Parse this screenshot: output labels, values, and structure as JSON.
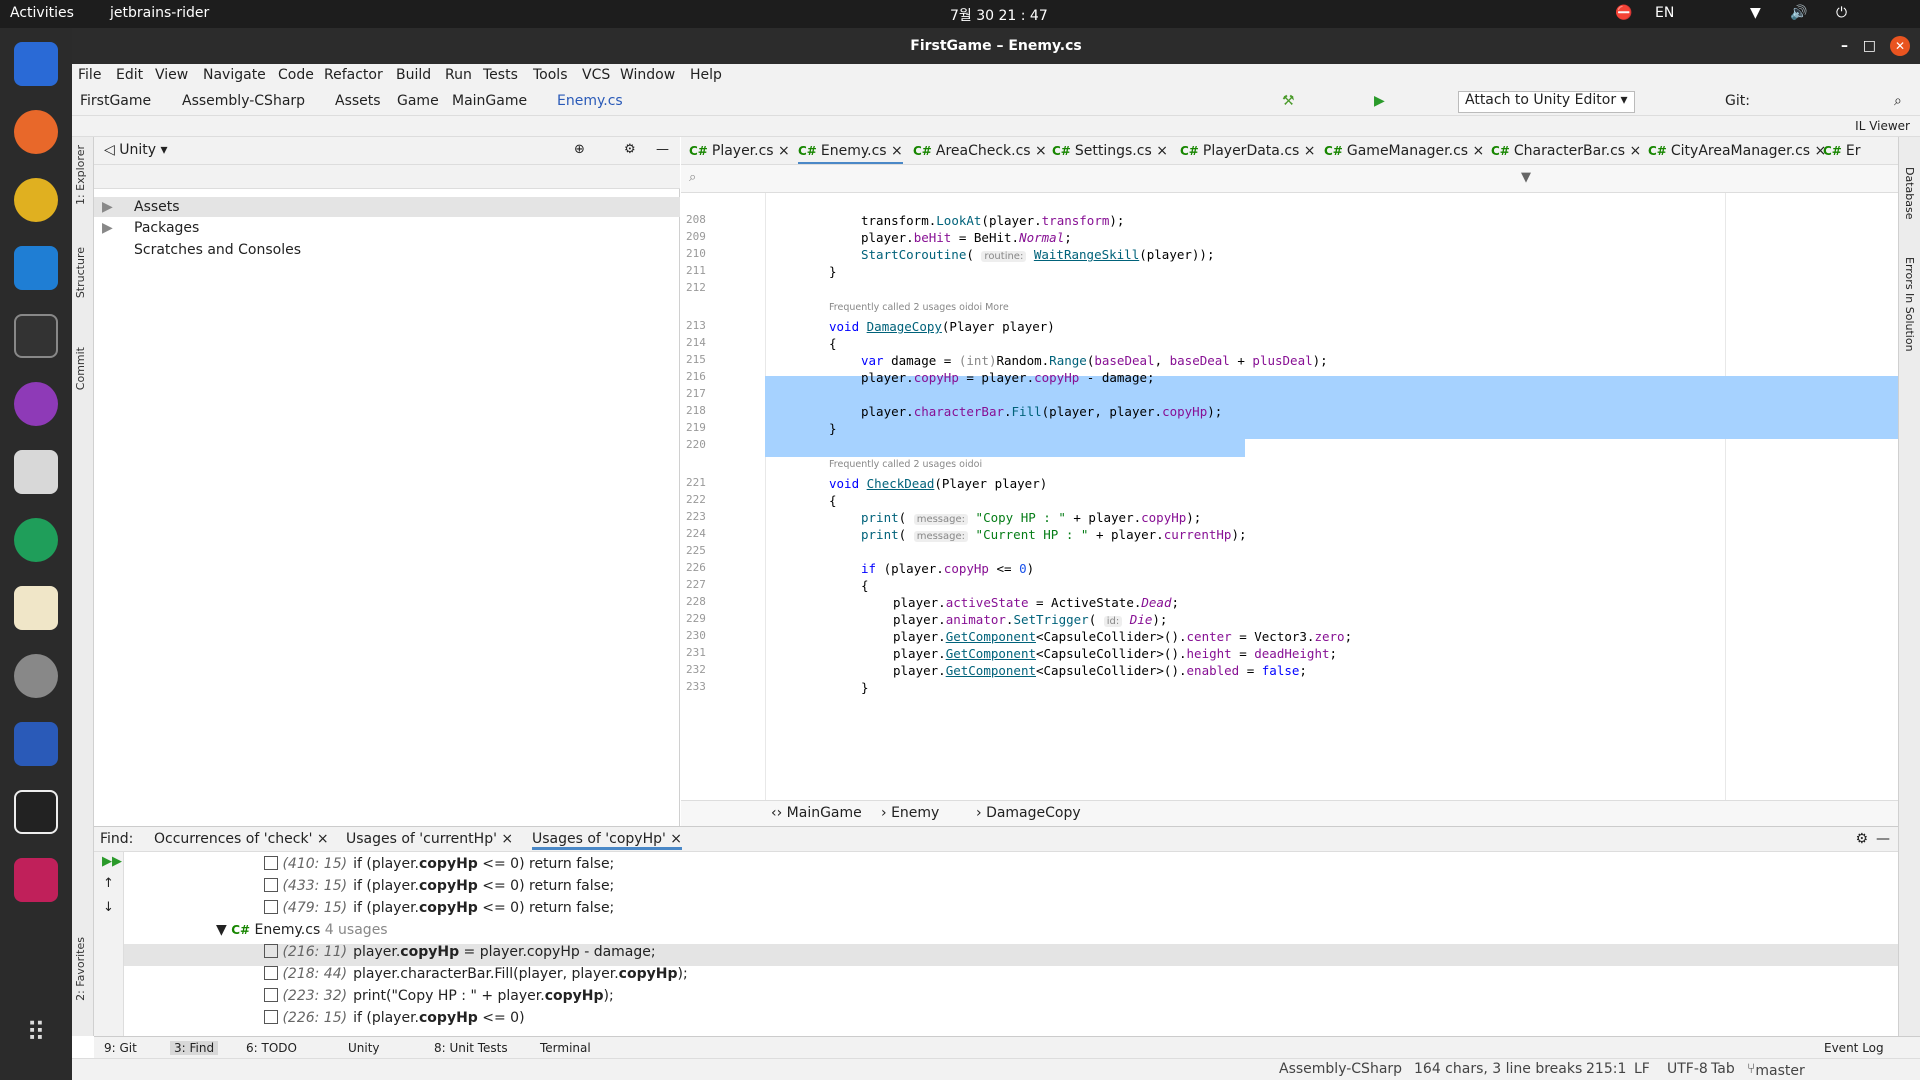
{
  "topbar": {
    "activities": "Activities",
    "app": "jetbrains-rider",
    "clock": "7월 30 21 : 47",
    "lang": "EN"
  },
  "window": {
    "title": "FirstGame – Enemy.cs"
  },
  "menu": [
    "File",
    "Edit",
    "View",
    "Navigate",
    "Code",
    "Refactor",
    "Build",
    "Run",
    "Tests",
    "Tools",
    "VCS",
    "Window",
    "Help"
  ],
  "nav": {
    "crumbs": [
      "FirstGame",
      "Assembly-CSharp",
      "Assets",
      "Game",
      "MainGame",
      "Enemy.cs"
    ],
    "attach": "Attach to Unity Editor",
    "git": "Git:",
    "ilviewer": "IL Viewer"
  },
  "left_strip": {
    "explorer": "1: Explorer",
    "structure": "Structure",
    "commit": "Commit",
    "favorites": "2: Favorites"
  },
  "explorer": {
    "title": "Unity",
    "items": [
      "Assets",
      "Packages",
      "Scratches and Consoles"
    ]
  },
  "tabs": [
    "Player.cs",
    "Enemy.cs",
    "AreaCheck.cs",
    "Settings.cs",
    "PlayerData.cs",
    "GameManager.cs",
    "CharacterBar.cs",
    "CityAreaManager.cs",
    "Er"
  ],
  "cs_prefix": "C#",
  "code": {
    "top": [
      {
        "n": "208",
        "t": "transform.LookAt(player.transform);"
      },
      {
        "n": "209",
        "t": "player.beHit = BeHit.Normal;"
      },
      {
        "n": "210",
        "t": "StartCoroutine( routine: WaitRangeSkill(player));"
      },
      {
        "n": "211",
        "t": "}"
      },
      {
        "n": "212",
        "t": ""
      }
    ],
    "meta1": "Frequently called   2 usages   oidoi   More",
    "meta2": "Frequently called   2 usages   oidoi",
    "lines": [
      {
        "n": "213",
        "t": "void DamageCopy(Player player)"
      },
      {
        "n": "214",
        "t": "{"
      },
      {
        "n": "215",
        "t": "var damage = (int)Random.Range(baseDeal, baseDeal + plusDeal);"
      },
      {
        "n": "216",
        "t": "player.copyHp = player.copyHp - damage;"
      },
      {
        "n": "217",
        "t": ""
      },
      {
        "n": "218",
        "t": "player.characterBar.Fill(player, player.copyHp);"
      },
      {
        "n": "219",
        "t": "}"
      },
      {
        "n": "220",
        "t": ""
      }
    ],
    "lines2": [
      {
        "n": "221",
        "t": "void CheckDead(Player player)"
      },
      {
        "n": "222",
        "t": "{"
      },
      {
        "n": "223",
        "t": "print( message: \"Copy HP : \" + player.copyHp);"
      },
      {
        "n": "224",
        "t": "print( message: \"Current HP : \" + player.currentHp);"
      },
      {
        "n": "225",
        "t": ""
      },
      {
        "n": "226",
        "t": "if (player.copyHp <= 0)"
      },
      {
        "n": "227",
        "t": "{"
      },
      {
        "n": "228",
        "t": "player.activeState = ActiveState.Dead;"
      },
      {
        "n": "229",
        "t": "player.animator.SetTrigger( id: Die);"
      },
      {
        "n": "230",
        "t": "player.GetComponent<CapsuleCollider>().center = Vector3.zero;"
      },
      {
        "n": "231",
        "t": "player.GetComponent<CapsuleCollider>().height = deadHeight;"
      },
      {
        "n": "232",
        "t": "player.GetComponent<CapsuleCollider>().enabled = false;"
      },
      {
        "n": "233",
        "t": "}"
      }
    ]
  },
  "breadcrumb": [
    "MainGame",
    "Enemy",
    "DamageCopy"
  ],
  "find": {
    "label": "Find:",
    "tabs": [
      "Occurrences of 'check'",
      "Usages of 'currentHp'",
      "Usages of 'copyHp'"
    ],
    "rows": [
      {
        "loc": "(410: 15)",
        "pre": "if (player.",
        "b": "copyHp",
        "post": " <= 0) return false;"
      },
      {
        "loc": "(433: 15)",
        "pre": "if (player.",
        "b": "copyHp",
        "post": " <= 0) return false;"
      },
      {
        "loc": "(479: 15)",
        "pre": "if (player.",
        "b": "copyHp",
        "post": " <= 0) return false;"
      }
    ],
    "group": {
      "name": "Enemy.cs",
      "count": "4 usages"
    },
    "rows2": [
      {
        "loc": "(216: 11)",
        "pre": "player.",
        "b": "copyHp",
        "post": " = player.copyHp - damage;"
      },
      {
        "loc": "(218: 44)",
        "pre": "player.characterBar.Fill(player, player.",
        "b": "copyHp",
        "post": ");"
      },
      {
        "loc": "(223: 32)",
        "pre": "print(\"Copy HP : \" + player.",
        "b": "copyHp",
        "post": ");"
      },
      {
        "loc": "(226: 15)",
        "pre": "if (player.",
        "b": "copyHp",
        "post": " <= 0)"
      }
    ]
  },
  "right_strip": {
    "database": "Database",
    "errors": "Errors In Solution"
  },
  "bottom_tools": [
    "9: Git",
    "3: Find",
    "6: TODO",
    "Unity",
    "8: Unit Tests",
    "Terminal",
    "Event Log"
  ],
  "status": {
    "assembly": "Assembly-CSharp",
    "chars": "164 chars, 3 line breaks",
    "pos": "215:1",
    "lf": "LF",
    "enc": "UTF-8",
    "indent": "Tab",
    "branch": "master"
  }
}
